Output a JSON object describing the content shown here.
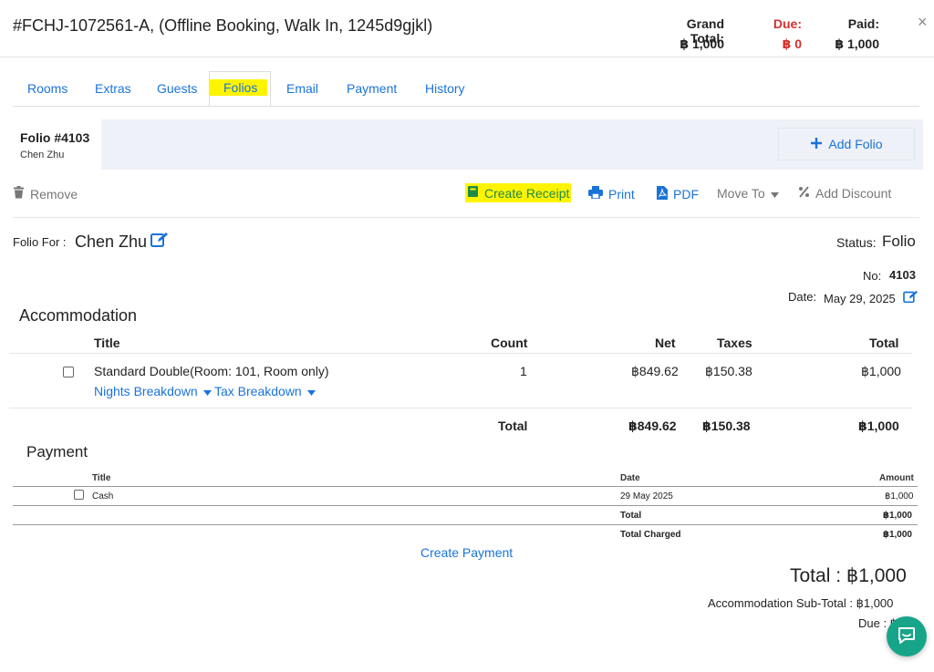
{
  "header": {
    "title": "#FCHJ-1072561-A, (Offline Booking, Walk In, 1245d9gjkl)",
    "grand_total_label": "Grand Total:",
    "grand_total_value": "฿ 1,000",
    "due_label": "Due:",
    "due_value": "฿ 0",
    "paid_label": "Paid:",
    "paid_value": "฿ 1,000",
    "close": "×"
  },
  "tabs": [
    {
      "label": "Rooms"
    },
    {
      "label": "Extras"
    },
    {
      "label": "Guests"
    },
    {
      "label": "Folios"
    },
    {
      "label": "Email"
    },
    {
      "label": "Payment"
    },
    {
      "label": "History"
    }
  ],
  "folio_bar": {
    "folio_number": "Folio #4103",
    "guest_name": "Chen Zhu",
    "add_folio": "Add Folio"
  },
  "toolbar": {
    "remove": "Remove",
    "create_receipt": "Create Receipt",
    "print": "Print",
    "pdf": "PDF",
    "move_to": "Move To",
    "add_discount": "Add Discount"
  },
  "folio_info": {
    "folio_for_label": "Folio For :",
    "folio_for_name": "Chen Zhu",
    "status_label": "Status:",
    "status_value": "Folio",
    "no_label": "No:",
    "no_value": "4103",
    "date_label": "Date:",
    "date_value": "May 29, 2025"
  },
  "accommodation": {
    "title": "Accommodation",
    "columns": {
      "title": "Title",
      "count": "Count",
      "net": "Net",
      "taxes": "Taxes",
      "total": "Total"
    },
    "rows": [
      {
        "title": "Standard Double(Room: 101, Room only)",
        "count": "1",
        "net": "฿849.62",
        "taxes": "฿150.38",
        "total": "฿1,000",
        "nights_breakdown": "Nights Breakdown",
        "tax_breakdown": "Tax Breakdown"
      }
    ],
    "totals": {
      "label": "Total",
      "net": "฿849.62",
      "taxes": "฿150.38",
      "total": "฿1,000"
    }
  },
  "payment": {
    "title": "Payment",
    "columns": {
      "title": "Title",
      "date": "Date",
      "amount": "Amount"
    },
    "rows": [
      {
        "title": "Cash",
        "date": "29 May 2025",
        "amount": "฿1,000"
      }
    ],
    "total_label": "Total",
    "total_value": "฿1,000",
    "total_charged_label": "Total Charged",
    "total_charged_value": "฿1,000",
    "create_payment": "Create Payment"
  },
  "summary": {
    "total_line": "Total : ฿1,000",
    "subtotal_line": "Accommodation Sub-Total : ฿1,000",
    "due_line": "Due : ฿"
  },
  "colors": {
    "accent": "#1a73d9",
    "due": "#d32f2f",
    "highlight": "#fff400",
    "chat": "#17a589"
  }
}
